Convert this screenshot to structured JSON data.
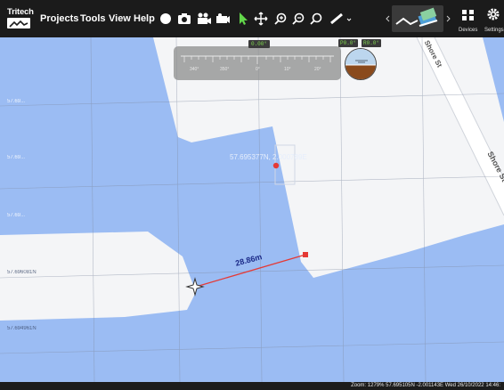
{
  "app": {
    "logo_text": "Tritech"
  },
  "menu": {
    "projects": "Projects",
    "tools": "Tools",
    "view": "View",
    "help": "Help"
  },
  "toolbar": {
    "icons": [
      "record-icon",
      "camera-icon",
      "video-icon",
      "snapshot-icon",
      "pointer-icon",
      "pan-icon",
      "zoom-in-icon",
      "zoom-out-icon",
      "zoom-reset-icon",
      "ruler-icon"
    ],
    "devices_label": "Devices",
    "settings_label": "Settings"
  },
  "compass": {
    "heading": "0.00°",
    "ticks": [
      "340°",
      "350°",
      "0°",
      "10°",
      "20°"
    ]
  },
  "attitude": {
    "pitch": "P0.0°",
    "roll": "R0.0°"
  },
  "map": {
    "latitudes": [
      "57.696633N",
      "57.696081N",
      "57.695529N",
      "57.694977N",
      "57.694425N"
    ],
    "left_labels": [
      "57.69...",
      "57.69...",
      "57.69..."
    ],
    "lat_marks": [
      "57.696081N",
      "57.694961N"
    ],
    "cursor_coord": "57.695377N, 2.000789E",
    "measurement": "28.86m",
    "streets": [
      "Shore St",
      "Shore St"
    ],
    "colors": {
      "water": "#9bbcf3",
      "land": "#f4f5f7",
      "road": "#ffffff",
      "measure_line": "#e53935"
    }
  },
  "status": {
    "text": "Zoom: 1279%  57.695105N  -2.001143E  Wed 26/10/2022 14:46:"
  }
}
